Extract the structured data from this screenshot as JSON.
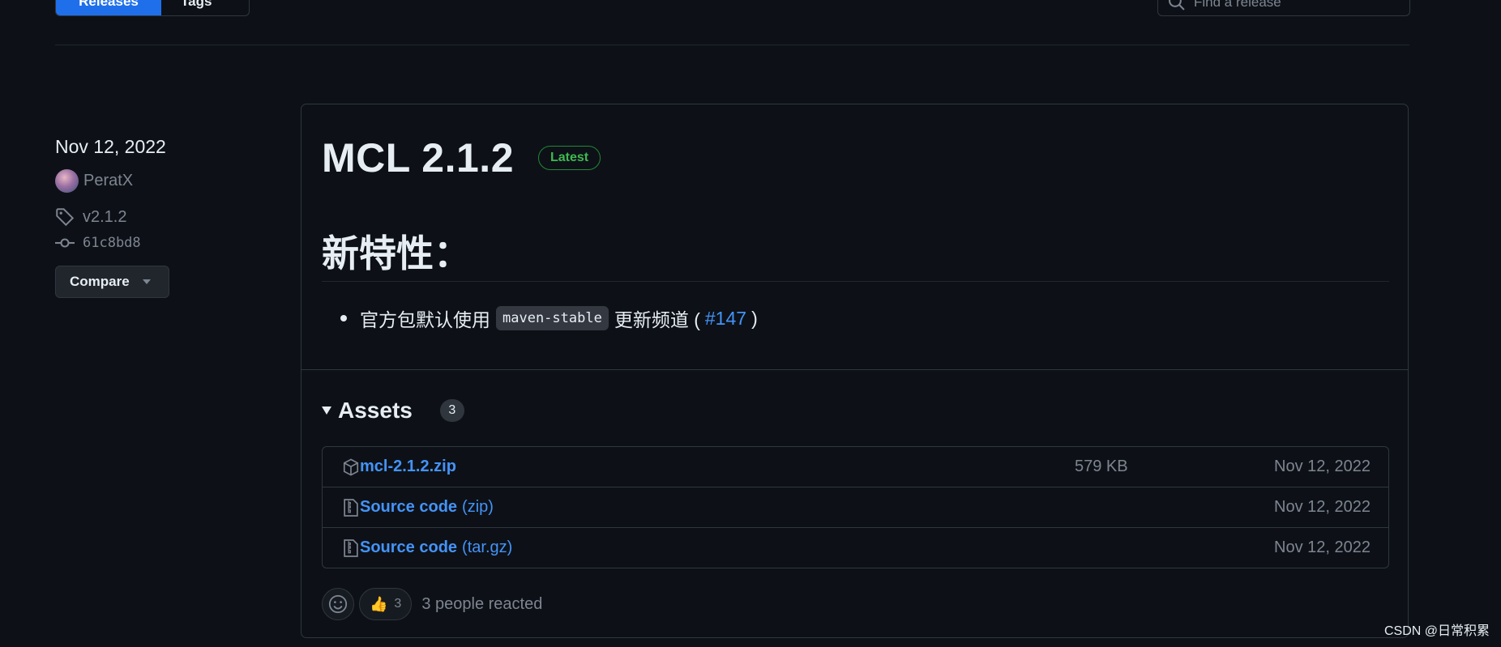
{
  "topbar": {
    "tabs": [
      {
        "label": "Releases"
      },
      {
        "label": "Tags"
      }
    ],
    "find_placeholder": "Find a release"
  },
  "meta": {
    "date": "Nov 12, 2022",
    "author": "PeratX",
    "tag": "v2.1.2",
    "commit": "61c8bd8",
    "compare_label": "Compare"
  },
  "release": {
    "title": "MCL 2.1.2",
    "badge": "Latest",
    "heading": "新特性：",
    "bullet": {
      "prefix": "官方包默认使用",
      "code": "maven-stable",
      "middle": "更新频道 (",
      "link": "#147",
      "suffix": ")"
    }
  },
  "assets": {
    "label": "Assets",
    "count": "3",
    "items": [
      {
        "name": "mcl-2.1.2.zip",
        "suffix": "",
        "size": "579 KB",
        "date": "Nov 12, 2022",
        "icon": "package-icon"
      },
      {
        "name": "Source code",
        "suffix": "(zip)",
        "size": "",
        "date": "Nov 12, 2022",
        "icon": "file-zip-icon"
      },
      {
        "name": "Source code",
        "suffix": "(tar.gz)",
        "size": "",
        "date": "Nov 12, 2022",
        "icon": "file-zip-icon"
      }
    ]
  },
  "reactions": {
    "thumbs_emoji": "👍",
    "thumbs_count": "3",
    "summary": "3 people reacted"
  },
  "watermark": "CSDN @日常积累",
  "colors": {
    "background": "#0d1117",
    "border": "#30363d",
    "accent_blue": "#4493f8",
    "latest_green": "#3fb950",
    "muted": "#7d8590"
  }
}
